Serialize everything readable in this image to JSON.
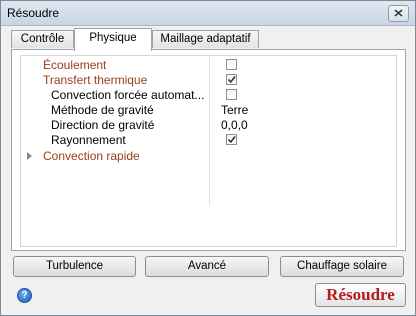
{
  "window": {
    "title": "Résoudre"
  },
  "tabs": [
    {
      "label": "Contrôle"
    },
    {
      "label": "Physique"
    },
    {
      "label": "Maillage adaptatif"
    }
  ],
  "properties": {
    "ecoulement": {
      "label": "Écoulement",
      "checked": false
    },
    "transfert": {
      "label": "Transfert thermique",
      "checked": true
    },
    "convection_forcee": {
      "label": "Convection forcée automat...",
      "checked": false
    },
    "methode_gravite": {
      "label": "Méthode de gravité",
      "value": "Terre"
    },
    "direction_gravite": {
      "label": "Direction de gravité",
      "value": "0,0,0"
    },
    "rayonnement": {
      "label": "Rayonnement",
      "checked": true
    },
    "convection_rapide": {
      "label": "Convection rapide"
    }
  },
  "buttons": {
    "turbulence": "Turbulence",
    "avance": "Avancé",
    "chauffage": "Chauffage solaire",
    "resoudre": "Résoudre",
    "help": "?"
  },
  "colors": {
    "section_label": "#9b3c1c",
    "solve_text": "#b01f1f"
  }
}
